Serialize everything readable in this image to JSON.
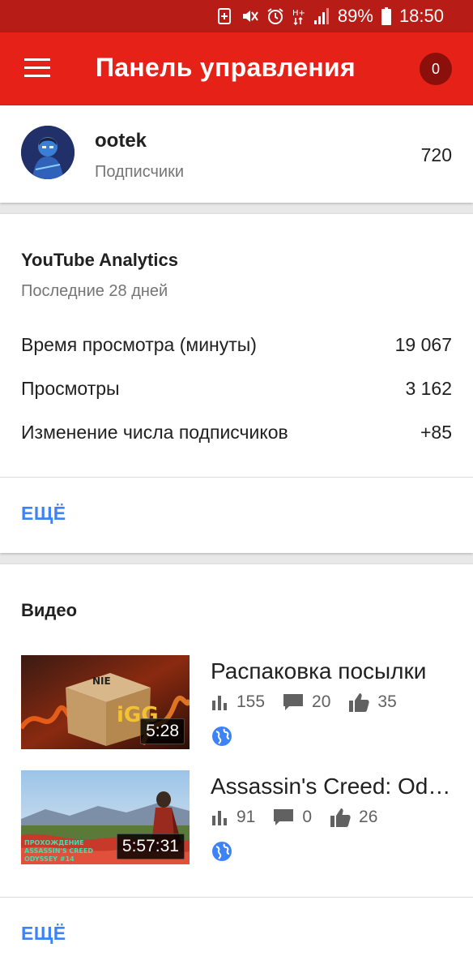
{
  "status_bar": {
    "battery_percent": "89%",
    "time": "18:50",
    "icons": [
      "data-saver-icon",
      "mute-icon",
      "alarm-icon",
      "h-plus-data-icon",
      "signal-icon",
      "battery-icon"
    ]
  },
  "app_bar": {
    "title": "Панель управления",
    "notifications_count": "0",
    "accent_color": "#e62117"
  },
  "channel": {
    "name": "ootek",
    "subscribers_label": "Подписчики",
    "subscribers_count": "720"
  },
  "analytics": {
    "title": "YouTube Analytics",
    "period": "Последние 28 дней",
    "metrics": [
      {
        "label": "Время просмотра (минуты)",
        "value": "19 067"
      },
      {
        "label": "Просмотры",
        "value": "3 162"
      },
      {
        "label": "Изменение числа подписчиков",
        "value": "+85"
      }
    ],
    "more_label": "ЕЩЁ"
  },
  "videos": {
    "title": "Видео",
    "items": [
      {
        "title": "Распаковка посылки",
        "duration": "5:28",
        "views": "155",
        "comments": "20",
        "likes": "35",
        "visibility": "public"
      },
      {
        "title": "Assassin's Creed: Odyssey",
        "duration": "5:57:31",
        "views": "91",
        "comments": "0",
        "likes": "26",
        "visibility": "public"
      }
    ],
    "more_label": "ЕЩЁ"
  }
}
